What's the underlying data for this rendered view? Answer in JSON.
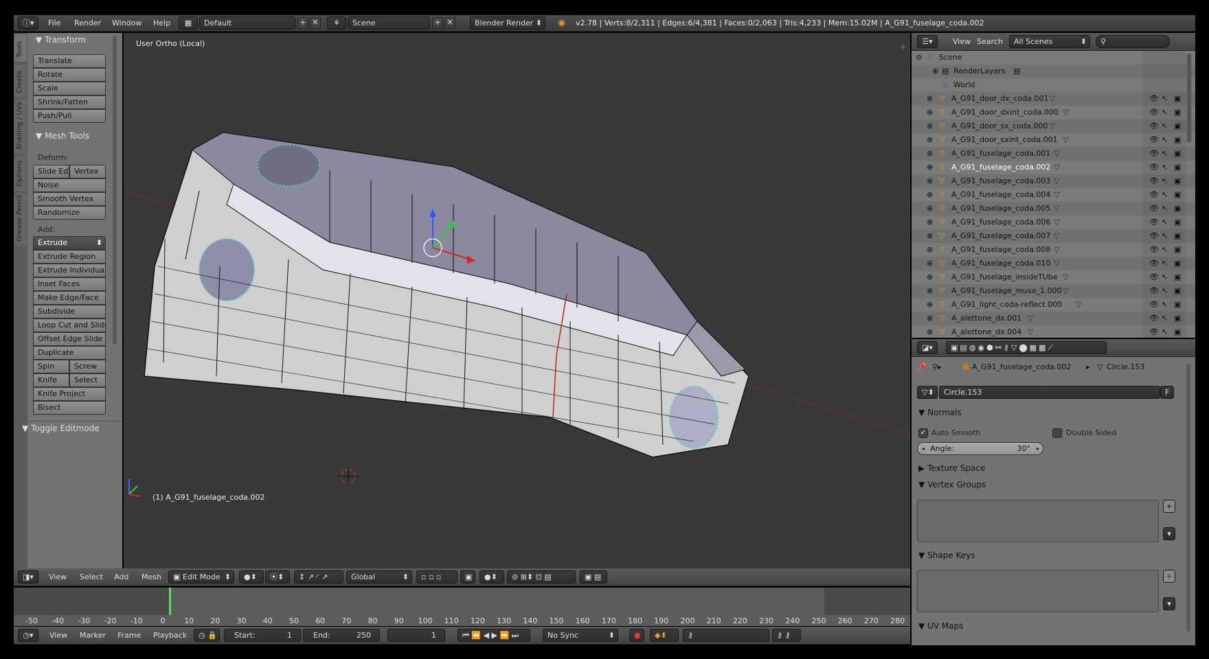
{
  "topbar": {
    "menus": [
      "File",
      "Render",
      "Window",
      "Help"
    ],
    "layout": "Default",
    "scene": "Scene",
    "engine": "Blender Render",
    "stats": "v2.78 | Verts:8/2,311 | Edges:6/4,381 | Faces:0/2,063 | Tris:4,233 | Mem:15.02M | A_G91_fuselage_coda.002"
  },
  "vtabs": [
    "Tools",
    "Create",
    "Shading / UVs",
    "Options",
    "Grease Pencil"
  ],
  "tools": {
    "transform_header": "Transform",
    "transform": [
      "Translate",
      "Rotate",
      "Scale",
      "Shrink/Fatten",
      "Push/Pull"
    ],
    "meshtools_header": "Mesh Tools",
    "deform_label": "Deform:",
    "slide_edge": "Slide Ed",
    "vertex": "Vertex",
    "deform": [
      "Noise",
      "Smooth Vertex",
      "Randomize"
    ],
    "add_label": "Add:",
    "extrude": "Extrude",
    "add": [
      "Extrude Region",
      "Extrude Individual",
      "Inset Faces",
      "Make Edge/Face",
      "Subdivide",
      "Loop Cut and Slide",
      "Offset Edge Slide",
      "Duplicate"
    ],
    "spin": "Spin",
    "screw": "Screw",
    "knife": "Knife",
    "select": "Select",
    "more": [
      "Knife Project",
      "Bisect"
    ],
    "toggle": "Toggle Editmode"
  },
  "viewport": {
    "view_label": "User Ortho (Local)",
    "object_label": "(1) A_G91_fuselage_coda.002"
  },
  "viewheader": {
    "menus": [
      "View",
      "Select",
      "Add",
      "Mesh"
    ],
    "mode": "Edit Mode",
    "orientation": "Global"
  },
  "timeline": {
    "ticks": [
      "-50",
      "-40",
      "-30",
      "-20",
      "-10",
      "0",
      "10",
      "20",
      "30",
      "40",
      "50",
      "60",
      "70",
      "80",
      "90",
      "100",
      "110",
      "120",
      "130",
      "140",
      "150",
      "160",
      "170",
      "180",
      "190",
      "200",
      "210",
      "220",
      "230",
      "240",
      "250",
      "260",
      "270",
      "280"
    ],
    "menus": [
      "View",
      "Marker",
      "Frame",
      "Playback"
    ],
    "start_label": "Start:",
    "start": "1",
    "end_label": "End:",
    "end": "250",
    "current": "1",
    "sync": "No Sync"
  },
  "outliner": {
    "menus": [
      "View",
      "Search"
    ],
    "filter": "All Scenes",
    "scene": "Scene",
    "renderlayers": "RenderLayers",
    "world": "World",
    "items": [
      "A_G91_door_dx_coda.001",
      "A_G91_door_dxint_coda.000",
      "A_G91_door_sx_coda.000",
      "A_G91_door_sxint_coda.001",
      "A_G91_fuselage_coda.001",
      "A_G91_fuselage_coda.002",
      "A_G91_fuselage_coda.003",
      "A_G91_fuselage_coda.004",
      "A_G91_fuselage_coda.005",
      "A_G91_fuselage_coda.006",
      "A_G91_fuselage_coda.007",
      "A_G91_fuselage_coda.008",
      "A_G91_fuselage_coda.010",
      "A_G91_fuselage_insideTUbe",
      "A_G91_fuselage_muso_1.000",
      "A_G91_light_coda-reflect.000",
      "A_alettone_dx.001",
      "A_alettone_dx.004"
    ],
    "selected_index": 5
  },
  "properties": {
    "breadcrumb_object": "A_G91_fuselage_coda.002",
    "breadcrumb_mesh": "Circle.153",
    "mesh_name": "Circle.153",
    "fake_user": "F",
    "normals": "Normals",
    "auto_smooth": "Auto Smooth",
    "double_sided": "Double Sided",
    "angle_label": "Angle:",
    "angle": "30°",
    "texture_space": "Texture Space",
    "vertex_groups": "Vertex Groups",
    "shape_keys": "Shape Keys",
    "uv_maps": "UV Maps"
  }
}
